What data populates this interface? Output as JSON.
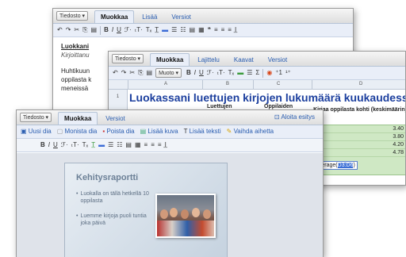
{
  "doc": {
    "file_label": "Tiedosto ▾",
    "tabs": [
      "Muokkaa",
      "Lisää",
      "Versiot"
    ],
    "toolbar": [
      "↶",
      "↷",
      "✂",
      "⎘",
      "▤",
      "B",
      "I",
      "U",
      "ℱ·",
      "ₜT·",
      "Tₓ",
      "T̲",
      "▬",
      "☰",
      "☷",
      "▤",
      "▦",
      "❝",
      "≡",
      "≡",
      "≡",
      "I̲"
    ],
    "text": [
      "Luokkani",
      "Kirjoittanu",
      "Huhtikuun",
      "oppilasta k",
      "meneissä"
    ]
  },
  "sheet": {
    "file_label": "Tiedosto ▾",
    "tabs": [
      "Muokkaa",
      "Lajittelu",
      "Kaavat",
      "Versiot"
    ],
    "format_label": "Muoto ▾",
    "toolbar": [
      "↶",
      "↷",
      "✂",
      "⎘",
      "▤",
      "B",
      "I",
      "U",
      "ℱ·",
      "ₜT·",
      "Tₓ",
      "▬",
      "☰",
      "Σ",
      "◉",
      "⁺1",
      "¹⁺"
    ],
    "col_headers": [
      "A",
      "B",
      "C",
      "D"
    ],
    "row1_num": "1",
    "title_cell": "Luokassani luettujen kirjojen lukumäärä kuukaudessa",
    "col_c_header": "Oppilaiden",
    "col_b_header": "Luettujen",
    "col_d_header": "Kirjaa oppilasta kohti (keskimäärin)",
    "values": [
      "3.40",
      "3.80",
      "4.20",
      "4.78"
    ],
    "formula_text": "average(",
    "formula_range": "D3:D6",
    "formula_close": ")"
  },
  "pres": {
    "file_label": "Tiedosto ▾",
    "tabs": [
      "Muokkaa",
      "Versiot"
    ],
    "present_label": "Aloita esitys",
    "actions": [
      "Uusi dia",
      "Monista dia",
      "Poista dia",
      "Lisää kuva",
      "Lisää teksti",
      "Vaihda aihetta"
    ],
    "slide": {
      "title": "Kehitysraportti",
      "bullets": [
        "Luokalla on tällä hetkellä 10 oppilasta",
        "Luemme kirjoja puoli tuntia joka päivä"
      ]
    }
  }
}
